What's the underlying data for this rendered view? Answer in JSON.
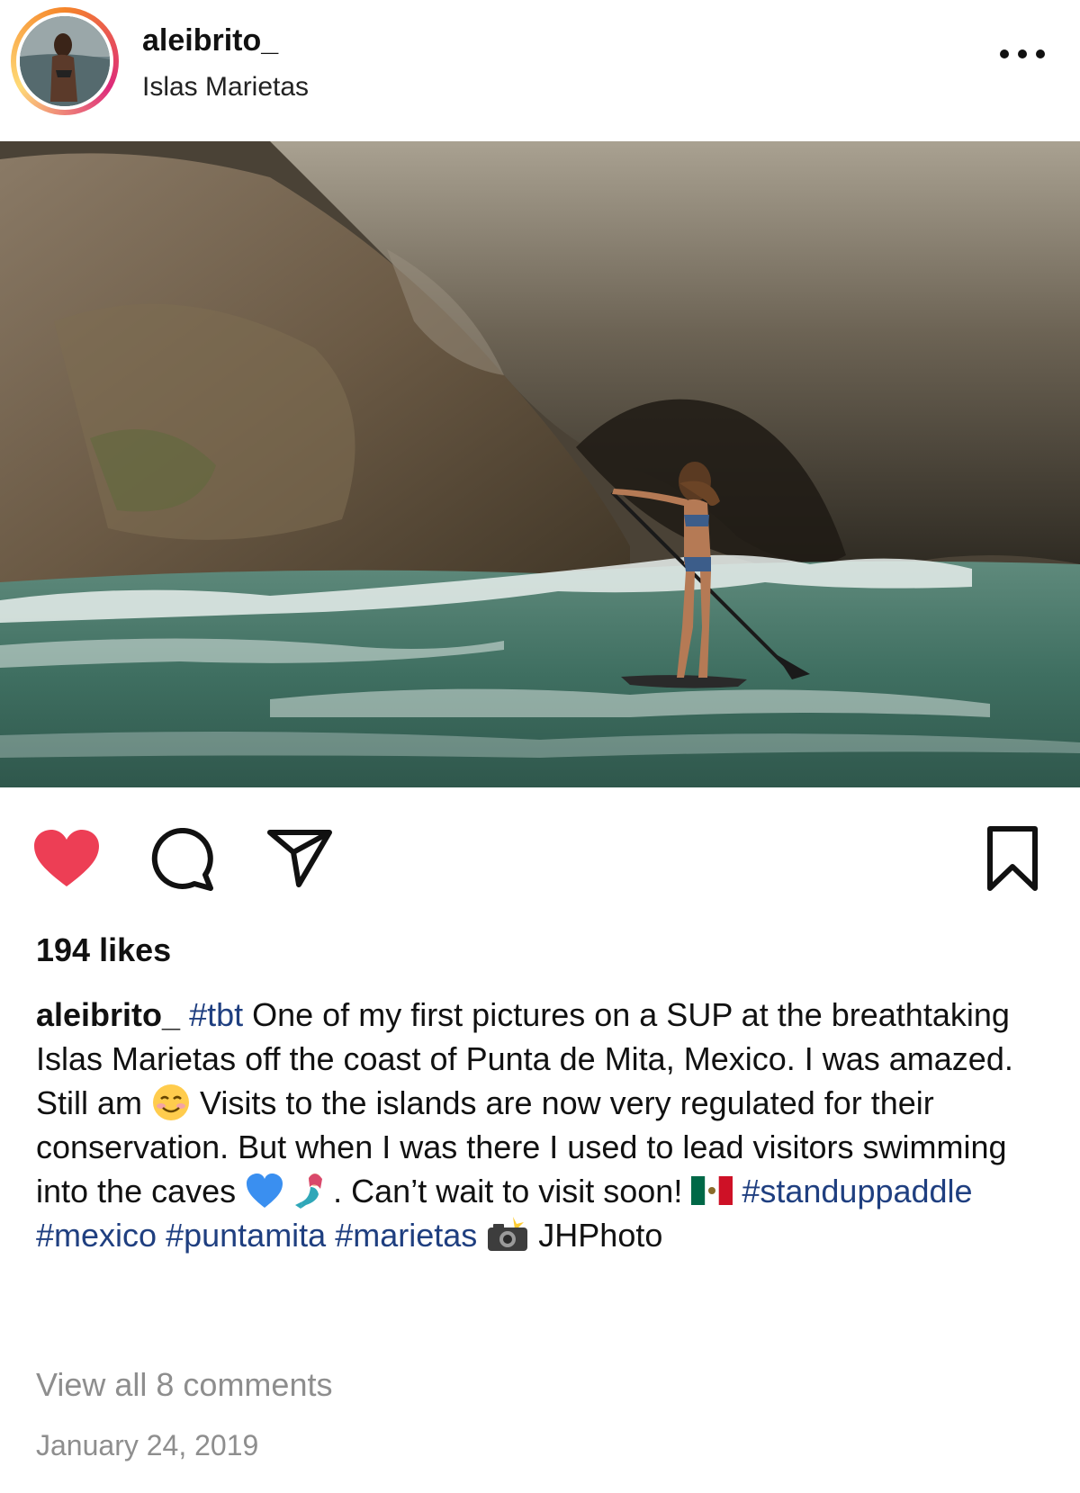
{
  "header": {
    "username": "aleibrito_",
    "location": "Islas Marietas"
  },
  "post": {
    "likes_text": "194 likes",
    "caption": {
      "username": "aleibrito_",
      "segments": [
        {
          "text": "#tbt",
          "type": "hashtag"
        },
        {
          "text": " One of my first pictures on a SUP at the breathtaking Islas Marietas off the coast of Punta de Mita, Mexico. I was amazed. Still am ",
          "type": "text"
        },
        {
          "emoji": "smiling-face-icon"
        },
        {
          "text": " Visits to the islands are now very regulated for their conservation. But when I was there I used to lead visitors swimming into the caves ",
          "type": "text"
        },
        {
          "emoji": "blue-heart-icon"
        },
        {
          "text": " ",
          "type": "text"
        },
        {
          "emoji": "mermaid-icon"
        },
        {
          "text": ". Can’t wait to visit soon! ",
          "type": "text"
        },
        {
          "emoji": "mexico-flag-icon"
        },
        {
          "text": " ",
          "type": "text"
        },
        {
          "text": "#standuppaddle",
          "type": "hashtag"
        },
        {
          "text": " ",
          "type": "text"
        },
        {
          "text": "#mexico",
          "type": "hashtag"
        },
        {
          "text": " ",
          "type": "text"
        },
        {
          "text": "#puntamita",
          "type": "hashtag"
        },
        {
          "text": " ",
          "type": "text"
        },
        {
          "text": "#marietas",
          "type": "hashtag"
        },
        {
          "text": " ",
          "type": "text"
        },
        {
          "emoji": "camera-flash-icon"
        },
        {
          "text": " JHPhoto",
          "type": "text"
        }
      ]
    },
    "view_comments": "View all 8 comments",
    "date": "January 24, 2019"
  },
  "icons": {
    "like": "heart-filled-icon",
    "comment": "comment-icon",
    "share": "send-icon",
    "save": "bookmark-icon",
    "more": "more-horizontal-icon"
  },
  "colors": {
    "like_red": "#ed3e55",
    "hashtag_blue": "#1f3f80",
    "muted_gray": "#8e8e8e"
  }
}
